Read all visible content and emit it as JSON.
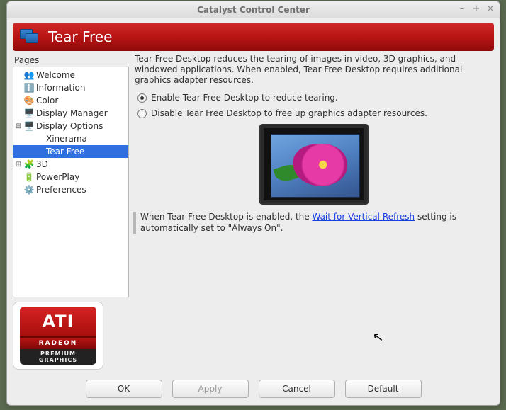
{
  "window": {
    "title": "Catalyst Control Center"
  },
  "header": {
    "title": "Tear Free"
  },
  "sidebar": {
    "label": "Pages",
    "items": [
      {
        "label": "Welcome",
        "depth": 1,
        "twisty": "",
        "icon": "👥",
        "name": "welcome"
      },
      {
        "label": "Information",
        "depth": 1,
        "twisty": "",
        "icon": "ℹ️",
        "name": "information"
      },
      {
        "label": "Color",
        "depth": 1,
        "twisty": "",
        "icon": "🎨",
        "name": "color"
      },
      {
        "label": "Display Manager",
        "depth": 1,
        "twisty": "",
        "icon": "🖥️",
        "name": "display-manager"
      },
      {
        "label": "Display Options",
        "depth": 1,
        "twisty": "⊟",
        "icon": "🖥️",
        "name": "display-options"
      },
      {
        "label": "Xinerama",
        "depth": 2,
        "twisty": "",
        "icon": "",
        "name": "xinerama"
      },
      {
        "label": "Tear Free",
        "depth": 2,
        "twisty": "",
        "icon": "",
        "name": "tear-free",
        "selected": true
      },
      {
        "label": "3D",
        "depth": 1,
        "twisty": "⊞",
        "icon": "🧩",
        "name": "3d"
      },
      {
        "label": "PowerPlay",
        "depth": 1,
        "twisty": "",
        "icon": "🔋",
        "name": "powerplay"
      },
      {
        "label": "Preferences",
        "depth": 1,
        "twisty": "",
        "icon": "⚙️",
        "name": "preferences"
      }
    ]
  },
  "logo": {
    "main": "ATI",
    "sub": "RADEON",
    "tag1": "PREMIUM",
    "tag2": "GRAPHICS"
  },
  "content": {
    "description": "Tear Free Desktop reduces the tearing of images in video, 3D graphics, and windowed applications. When enabled, Tear Free Desktop requires additional graphics adapter resources.",
    "radio_enable": "Enable Tear Free Desktop to reduce tearing.",
    "radio_disable": "Disable Tear Free Desktop to free up graphics adapter resources.",
    "selected": "enable",
    "note_pre": "When Tear Free Desktop is enabled, the ",
    "note_link": "Wait for Vertical Refresh",
    "note_post": " setting is automatically set to \"Always On\"."
  },
  "buttons": {
    "ok": "OK",
    "apply": "Apply",
    "cancel": "Cancel",
    "default": "Default"
  }
}
